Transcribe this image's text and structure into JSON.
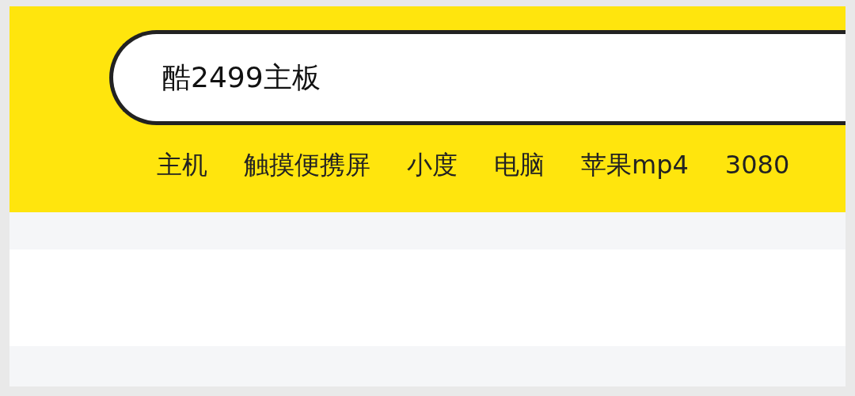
{
  "search": {
    "value": "酷2499主板"
  },
  "suggestions": [
    "主机",
    "触摸便携屏",
    "小度",
    "电脑",
    "苹果mp4",
    "3080"
  ]
}
